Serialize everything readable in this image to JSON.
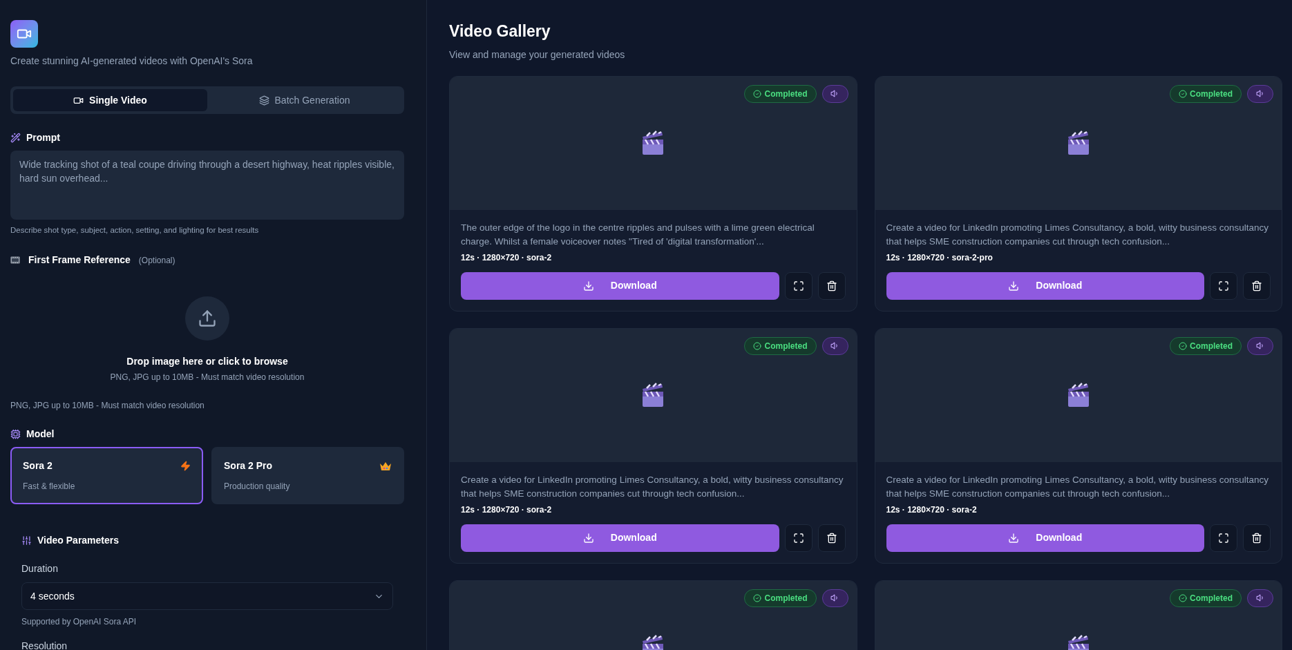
{
  "app": {
    "tagline": "Create stunning AI-generated videos with OpenAI's Sora"
  },
  "mode_tabs": [
    {
      "label": "Single Video",
      "selected": true,
      "kind": "video"
    },
    {
      "label": "Batch Generation",
      "selected": false,
      "kind": "layers"
    }
  ],
  "prompt": {
    "label": "Prompt",
    "placeholder": "Wide tracking shot of a teal coupe driving through a desert highway, heat ripples visible, hard sun overhead...",
    "hint": "Describe shot type, subject, action, setting, and lighting for best results"
  },
  "first_frame": {
    "label": "First Frame Reference",
    "optional": "(Optional)",
    "drop_title": "Drop image here or click to browse",
    "drop_hint": "PNG, JPG up to 10MB - Must match video resolution",
    "hint": "PNG, JPG up to 10MB - Must match video resolution"
  },
  "model": {
    "label": "Model",
    "options": [
      {
        "name": "Sora 2",
        "description": "Fast & flexible",
        "kind": "fast",
        "selected": true
      },
      {
        "name": "Sora 2 Pro",
        "description": "Production quality",
        "kind": "pro",
        "selected": false
      }
    ]
  },
  "video_parameters": {
    "title": "Video Parameters",
    "duration": {
      "label": "Duration",
      "value": "4 seconds",
      "hint": "Supported by OpenAI Sora API"
    },
    "resolution": {
      "label": "Resolution"
    }
  },
  "gallery": {
    "title": "Video Gallery",
    "subtitle": "View and manage your generated videos",
    "videos": [
      {
        "status": "Completed",
        "audio": true,
        "description": "The outer edge of the logo in the centre ripples and pulses with a lime green electrical charge. Whilst a female voiceover notes \"Tired of 'digital transformation'...",
        "meta": "12s · 1280×720 · sora-2",
        "download": "Download"
      },
      {
        "status": "Completed",
        "audio": true,
        "description": "Create a video for LinkedIn promoting Limes Consultancy, a bold, witty business consultancy that helps SME construction companies cut through tech confusion...",
        "meta": "12s · 1280×720 · sora-2-pro",
        "download": "Download"
      },
      {
        "status": "Completed",
        "audio": true,
        "description": "Create a video for LinkedIn promoting Limes Consultancy, a bold, witty business consultancy that helps SME construction companies cut through tech confusion...",
        "meta": "12s · 1280×720 · sora-2",
        "download": "Download"
      },
      {
        "status": "Completed",
        "audio": true,
        "description": "Create a video for LinkedIn promoting Limes Consultancy, a bold, witty business consultancy that helps SME construction companies cut through tech confusion...",
        "meta": "12s · 1280×720 · sora-2",
        "download": "Download"
      },
      {
        "status": "Completed",
        "audio": true
      },
      {
        "status": "Completed",
        "audio": true
      }
    ]
  }
}
